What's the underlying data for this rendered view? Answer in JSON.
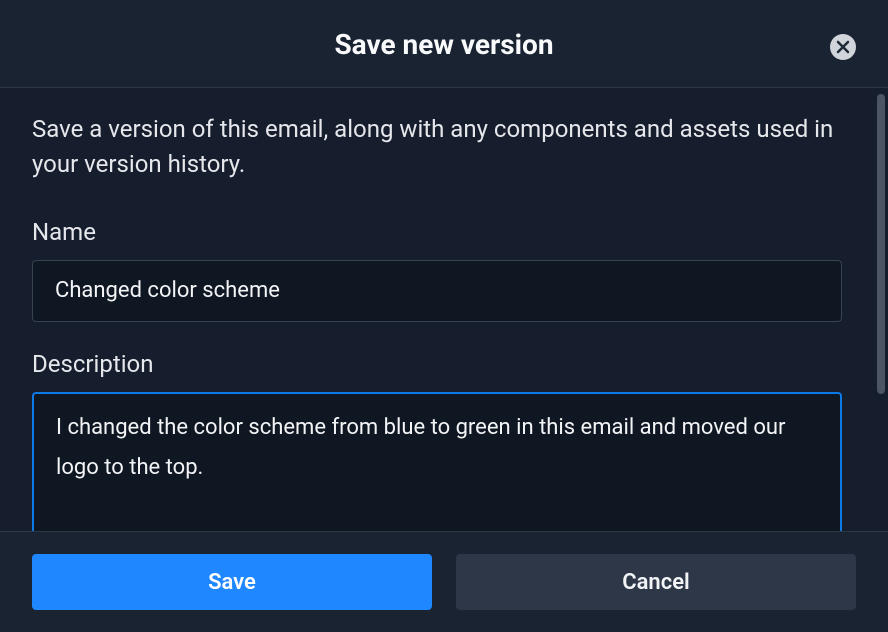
{
  "header": {
    "title": "Save new version"
  },
  "body": {
    "intro": "Save a version of this email, along with any components and assets used in your version history.",
    "name_label": "Name",
    "name_value": "Changed color scheme",
    "description_label": "Description",
    "description_value": "I changed the color scheme from blue to green in this email and moved our logo to the top. "
  },
  "footer": {
    "save_label": "Save",
    "cancel_label": "Cancel"
  }
}
